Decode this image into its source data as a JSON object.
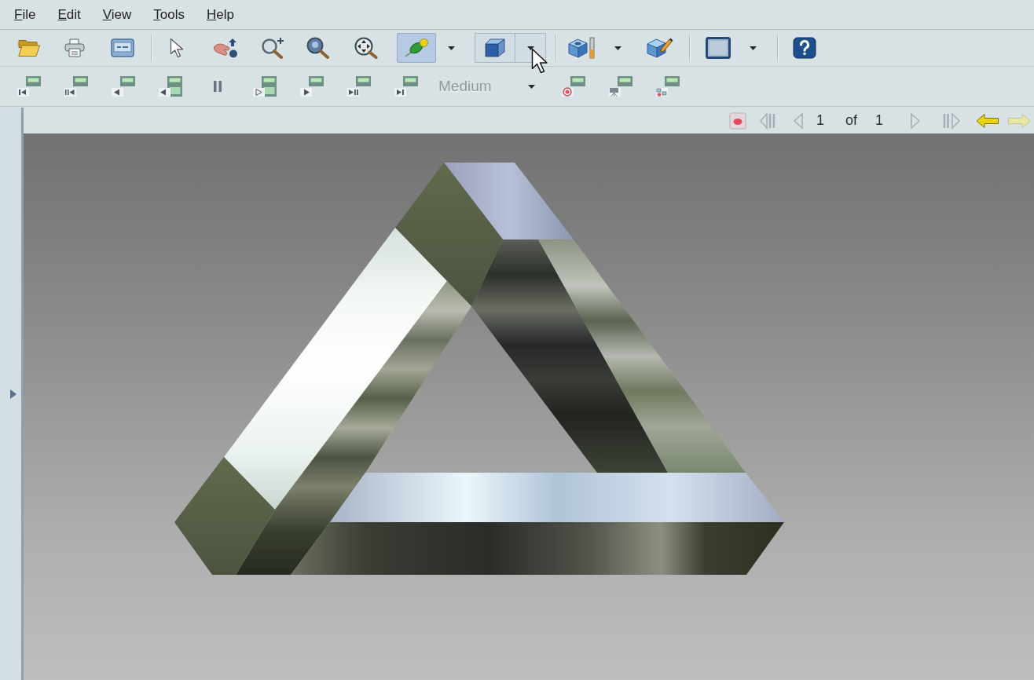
{
  "menu": [
    {
      "label": "File"
    },
    {
      "label": "Edit"
    },
    {
      "label": "View"
    },
    {
      "label": "Tools"
    },
    {
      "label": "Help"
    }
  ],
  "toolbar_1": [
    {
      "kind": "button",
      "selected": false
    },
    {
      "kind": "button",
      "selected": false
    },
    {
      "kind": "button",
      "selected": false
    },
    {
      "kind": "separator"
    },
    {
      "kind": "button",
      "selected": false
    },
    {
      "kind": "button",
      "selected": false
    },
    {
      "kind": "button",
      "selected": false
    },
    {
      "kind": "button",
      "selected": false
    },
    {
      "kind": "button",
      "selected": false
    },
    {
      "kind": "button",
      "selected": true
    },
    {
      "kind": "caret"
    },
    {
      "kind": "split",
      "hovered": true
    },
    {
      "kind": "separator"
    },
    {
      "kind": "button",
      "selected": false
    },
    {
      "kind": "caret"
    },
    {
      "kind": "button",
      "selected": false
    },
    {
      "kind": "separator"
    },
    {
      "kind": "button",
      "selected": false
    },
    {
      "kind": "caret"
    },
    {
      "kind": "separator"
    },
    {
      "kind": "button",
      "selected": false
    }
  ],
  "toolbar_2": [
    {
      "kind": "button"
    },
    {
      "kind": "button"
    },
    {
      "kind": "button"
    },
    {
      "kind": "button"
    },
    {
      "kind": "button"
    },
    {
      "kind": "button"
    },
    {
      "kind": "button"
    },
    {
      "kind": "button"
    },
    {
      "kind": "button"
    },
    {
      "kind": "combo",
      "value": "Medium",
      "disabled": true
    },
    {
      "kind": "button"
    },
    {
      "kind": "button"
    },
    {
      "kind": "button"
    }
  ],
  "navigator": {
    "record": {
      "disabled": false
    },
    "first": {
      "disabled": true
    },
    "previous": {
      "disabled": true
    },
    "current": "1",
    "of_label": "of",
    "total": "1",
    "next": {
      "disabled": true
    },
    "last": {
      "disabled": true
    },
    "back": {
      "disabled": false
    },
    "forward": {
      "disabled": true
    }
  },
  "side_panel": {
    "expanded": false
  }
}
